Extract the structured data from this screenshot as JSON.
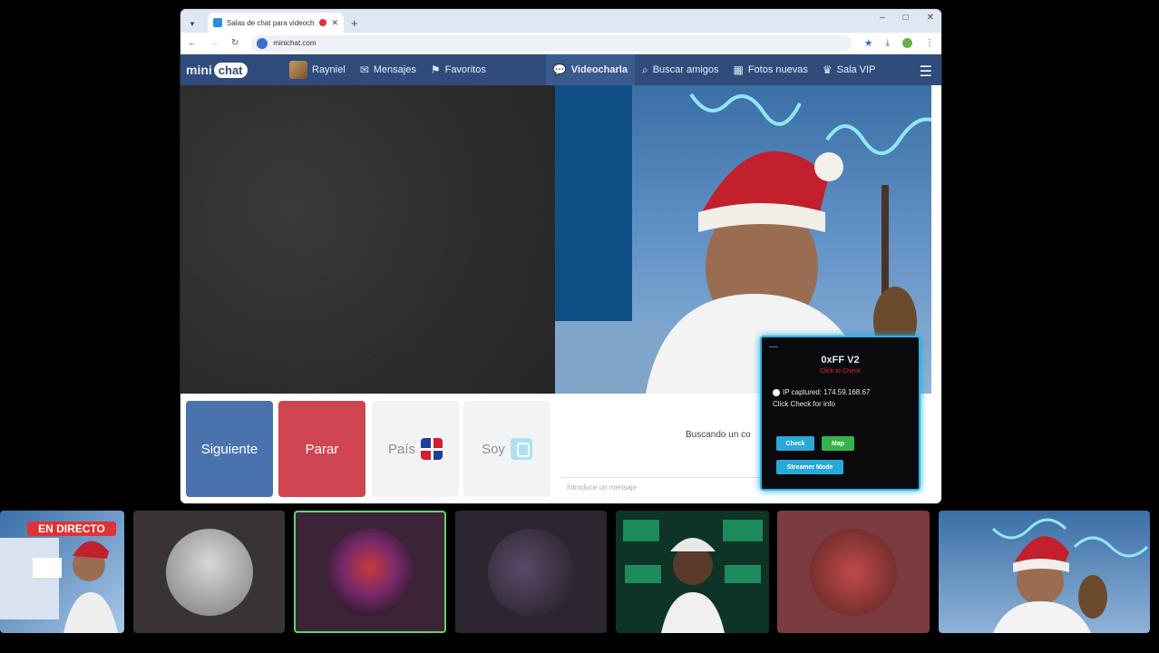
{
  "browser": {
    "tab_title": "Salas de chat para videochat",
    "new_tab_label": "+",
    "url": "minichat.com",
    "window_controls": [
      "–",
      "□",
      "✕"
    ]
  },
  "site": {
    "logo_left": "mini",
    "logo_right": "chat",
    "nav": [
      {
        "label": "Rayniel",
        "icon": "user-avatar"
      },
      {
        "label": "Mensajes",
        "icon": "mail-icon"
      },
      {
        "label": "Favoritos",
        "icon": "bookmark-icon"
      },
      {
        "label": "Videocharla",
        "icon": "chat-bubble-icon",
        "active": true
      },
      {
        "label": "Buscar amigos",
        "icon": "search-icon"
      },
      {
        "label": "Fotos nuevas",
        "icon": "grid-icon"
      },
      {
        "label": "Sala VIP",
        "icon": "crown-icon"
      }
    ]
  },
  "controls": {
    "next": "Siguiente",
    "stop": "Parar",
    "country": "País",
    "gender": "Soy",
    "searching": "Buscando un co",
    "message_placeholder": "Introduce un mensaje"
  },
  "panel": {
    "title": "0xFF V2",
    "subtitle": "Click to Check",
    "ip_line": "IP captured: 174.59.168.67",
    "info_line": "Click Check for info",
    "check": "Check",
    "map": "Map",
    "streamer": "Streamer Mode"
  },
  "strip": {
    "live_label": "EN DIRECTO"
  },
  "colors": {
    "nav_bg": "#2f4c7c",
    "next_btn": "#4a73ad",
    "stop_btn": "#cf4552",
    "panel_border": "#24b8e6"
  }
}
